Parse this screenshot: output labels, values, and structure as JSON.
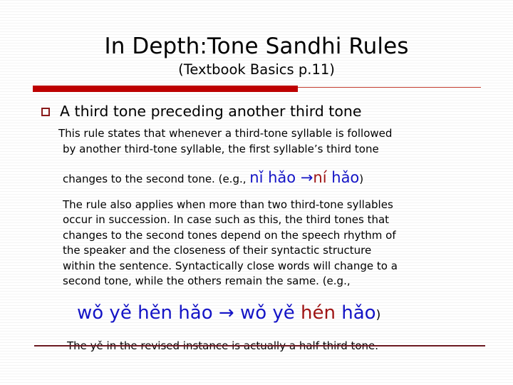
{
  "slide": {
    "title": "In Depth:Tone Sandhi Rules",
    "subtitle": "(Textbook Basics p.11)",
    "accent_color": "#C00000",
    "rule_bottom_color": "#6E1A22"
  },
  "bullet": {
    "glyph": "hollow-square",
    "glyph_color": "#8B1A1A",
    "text": "A third tone preceding another third tone"
  },
  "body": {
    "paragraph1": {
      "line1": "This rule states that whenever a third-tone syllable is followed",
      "line2": "by another third-tone syllable, the first syllable’s third tone"
    },
    "example1": {
      "lead": "changes to the second tone. (e.g.,",
      "pinyin_before": "nǐ hǎo ",
      "arrow": "→",
      "pinyin_changed": "ní",
      "pinyin_after": " hǎo",
      "close_paren": ")",
      "blue": "#1414C8",
      "red": "#A01414"
    },
    "paragraph2": {
      "line1": "The rule also applies when more than two third-tone syllables",
      "line2": "occur in succession. In case such as this, the third tones that",
      "line3": "changes to the second tones depend on the speech rhythm of",
      "line4": "the speaker and the closeness of their syntactic structure",
      "line5": "within the sentence. Syntactically close words will change to a",
      "line6": "second tone, while the others remain the same. (e.g.,"
    },
    "example2": {
      "pinyin_before": "wǒ yě hěn hǎo ",
      "arrow": "→",
      "pinyin_mid": " wǒ yě ",
      "pinyin_changed": "hén",
      "pinyin_after": " hǎo",
      "close_paren": ")"
    },
    "final_note": "The yě in the revised instance is actually a half third tone."
  }
}
